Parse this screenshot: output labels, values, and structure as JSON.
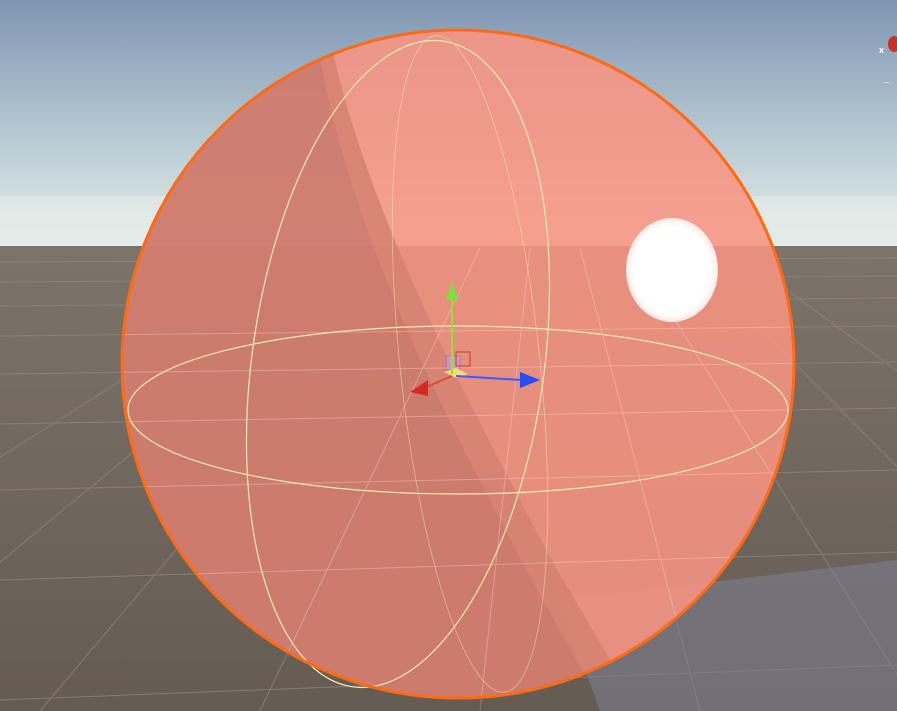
{
  "scene": {
    "colors": {
      "sky_top": "#7f96b3",
      "sky_horizon": "#e6f0ec",
      "ground": "#6b6259",
      "grid_line": "#8a8178",
      "sphere_fill": "#f79482",
      "sphere_shadow": "#c77868",
      "sphere_outline": "#ff6a14",
      "sphere_wire": "#f3ecb6",
      "highlight": "#ffffff",
      "axis_x": "#d62a1e",
      "axis_y": "#7be23a",
      "axis_z": "#2a4cf0"
    },
    "objects": {
      "sphere": "selected-sphere",
      "gizmo": "move-tool-gizmo"
    }
  },
  "orientation_gizmo": {
    "axis_label": "x",
    "axis_color": "#c8302a"
  }
}
